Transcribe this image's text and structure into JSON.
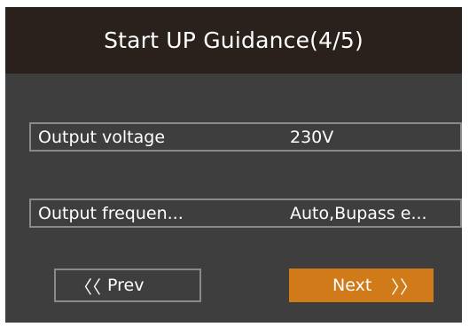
{
  "header": {
    "title": "Start UP Guidance(4/5)"
  },
  "fields": [
    {
      "label": "Output voltage",
      "value": "230V"
    },
    {
      "label": "Output frequen...",
      "value": "Auto,Bupass e..."
    }
  ],
  "nav": {
    "prev_label": "Prev",
    "prev_icon": "〈〈",
    "next_label": "Next",
    "next_icon": "〉〉",
    "next_color": "#d07a1a"
  },
  "colors": {
    "background": "#3e3e3e",
    "header": "#2a201c",
    "border": "#8a8a8a",
    "accent": "#d07a1a"
  }
}
